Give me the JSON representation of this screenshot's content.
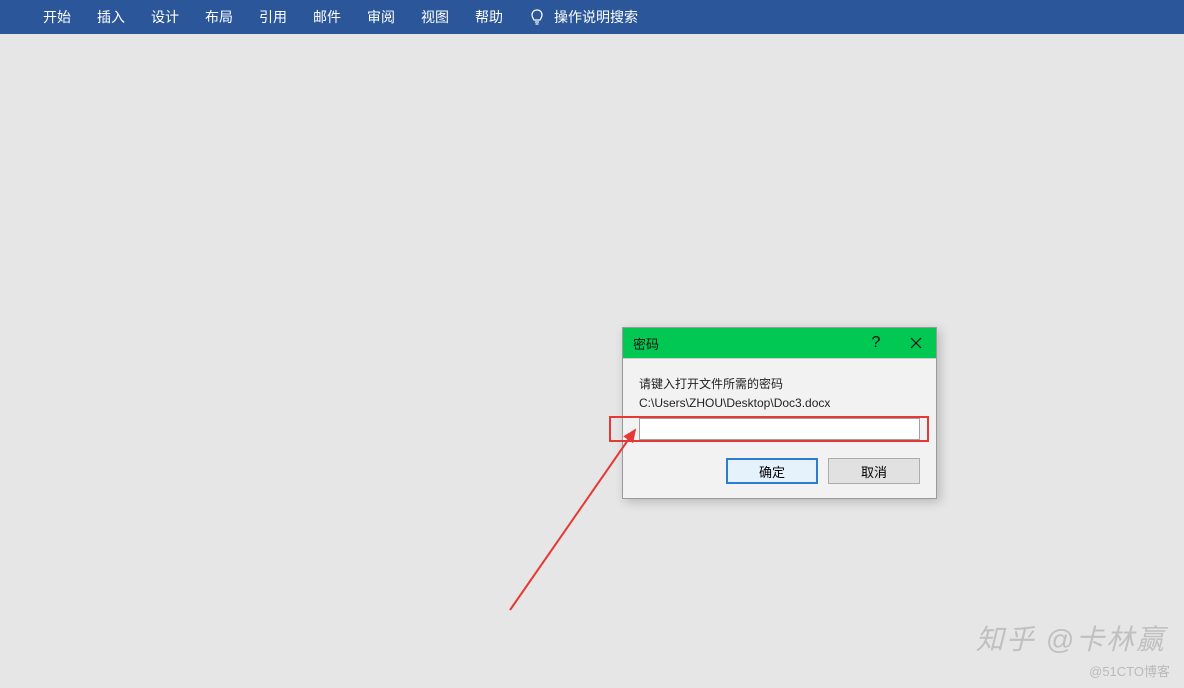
{
  "ribbon": {
    "tabs": [
      "开始",
      "插入",
      "设计",
      "布局",
      "引用",
      "邮件",
      "审阅",
      "视图",
      "帮助"
    ],
    "tell_me": "操作说明搜索"
  },
  "dialog": {
    "title": "密码",
    "help": "?",
    "prompt_line1": "请键入打开文件所需的密码",
    "prompt_line2": "C:\\Users\\ZHOU\\Desktop\\Doc3.docx",
    "ok_label": "确定",
    "cancel_label": "取消"
  },
  "watermark": {
    "main": "知乎 @卡林赢",
    "sub": "@51CTO博客"
  }
}
